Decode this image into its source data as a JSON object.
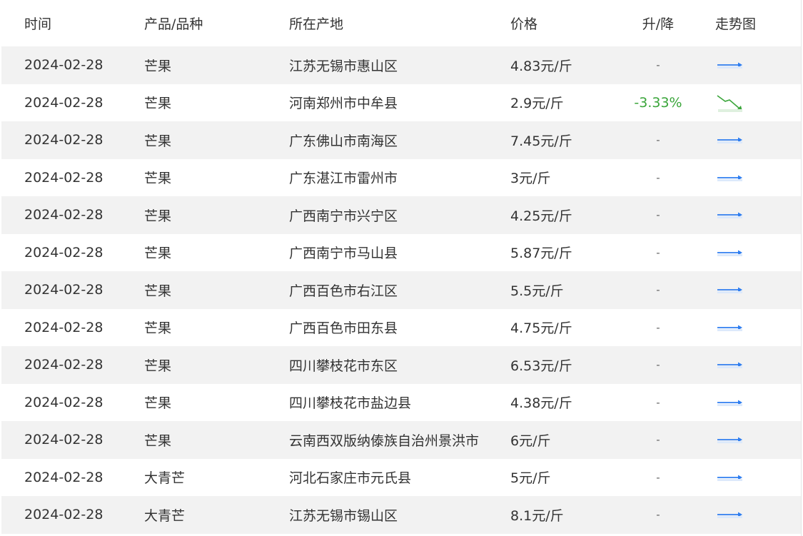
{
  "headers": {
    "time": "时间",
    "product": "产品/品种",
    "location": "所在产地",
    "price": "价格",
    "change": "升/降",
    "trend": "走势图"
  },
  "rows": [
    {
      "time": "2024-02-28",
      "product": "芒果",
      "location": "江苏无锡市惠山区",
      "price": "4.83元/斤",
      "change": "-",
      "trend": "flat"
    },
    {
      "time": "2024-02-28",
      "product": "芒果",
      "location": "河南郑州市中牟县",
      "price": "2.9元/斤",
      "change": "-3.33%",
      "trend": "down"
    },
    {
      "time": "2024-02-28",
      "product": "芒果",
      "location": "广东佛山市南海区",
      "price": "7.45元/斤",
      "change": "-",
      "trend": "flat"
    },
    {
      "time": "2024-02-28",
      "product": "芒果",
      "location": "广东湛江市雷州市",
      "price": "3元/斤",
      "change": "-",
      "trend": "flat"
    },
    {
      "time": "2024-02-28",
      "product": "芒果",
      "location": "广西南宁市兴宁区",
      "price": "4.25元/斤",
      "change": "-",
      "trend": "flat"
    },
    {
      "time": "2024-02-28",
      "product": "芒果",
      "location": "广西南宁市马山县",
      "price": "5.87元/斤",
      "change": "-",
      "trend": "flat"
    },
    {
      "time": "2024-02-28",
      "product": "芒果",
      "location": "广西百色市右江区",
      "price": "5.5元/斤",
      "change": "-",
      "trend": "flat"
    },
    {
      "time": "2024-02-28",
      "product": "芒果",
      "location": "广西百色市田东县",
      "price": "4.75元/斤",
      "change": "-",
      "trend": "flat"
    },
    {
      "time": "2024-02-28",
      "product": "芒果",
      "location": "四川攀枝花市东区",
      "price": "6.53元/斤",
      "change": "-",
      "trend": "flat"
    },
    {
      "time": "2024-02-28",
      "product": "芒果",
      "location": "四川攀枝花市盐边县",
      "price": "4.38元/斤",
      "change": "-",
      "trend": "flat"
    },
    {
      "time": "2024-02-28",
      "product": "芒果",
      "location": "云南西双版纳傣族自治州景洪市",
      "price": "6元/斤",
      "change": "-",
      "trend": "flat"
    },
    {
      "time": "2024-02-28",
      "product": "大青芒",
      "location": "河北石家庄市元氏县",
      "price": "5元/斤",
      "change": "-",
      "trend": "flat"
    },
    {
      "time": "2024-02-28",
      "product": "大青芒",
      "location": "江苏无锡市锡山区",
      "price": "8.1元/斤",
      "change": "-",
      "trend": "flat"
    }
  ],
  "colors": {
    "flat_arrow": "#2f7ef0",
    "down_arrow": "#3aa53a",
    "down_text": "#3aa53a"
  }
}
